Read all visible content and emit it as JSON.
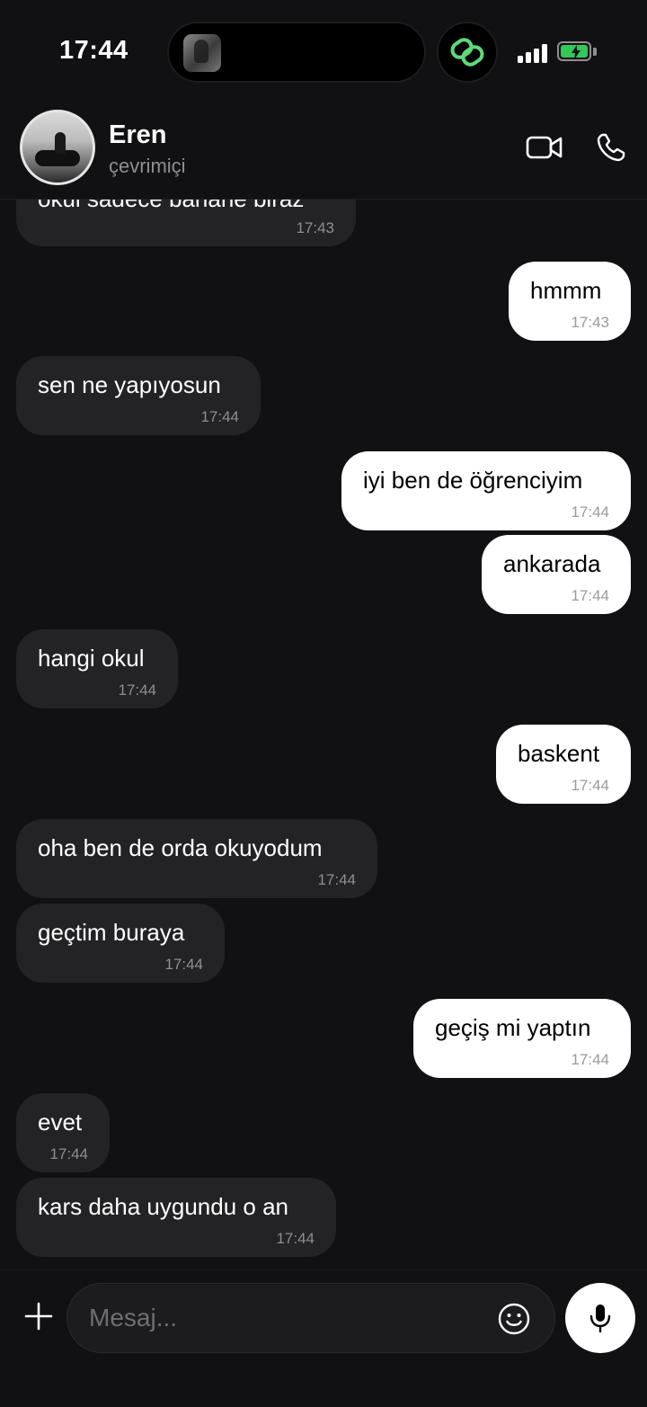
{
  "status_bar": {
    "time": "17:44"
  },
  "header": {
    "contact_name": "Eren",
    "contact_status": "çevrimiçi"
  },
  "messages": [
    {
      "direction": "incoming",
      "text": "okul sadece bahane biraz",
      "time": "17:43"
    },
    {
      "direction": "outgoing",
      "text": "hmmm",
      "time": "17:43"
    },
    {
      "direction": "incoming",
      "text": "sen ne yapıyosun",
      "time": "17:44"
    },
    {
      "direction": "outgoing",
      "text": "iyi ben de öğrenciyim",
      "time": "17:44"
    },
    {
      "direction": "outgoing",
      "text": "ankarada",
      "time": "17:44"
    },
    {
      "direction": "incoming",
      "text": "hangi okul",
      "time": "17:44"
    },
    {
      "direction": "outgoing",
      "text": "baskent",
      "time": "17:44"
    },
    {
      "direction": "incoming",
      "text": "oha ben de orda okuyodum",
      "time": "17:44"
    },
    {
      "direction": "incoming",
      "text": "geçtim buraya",
      "time": "17:44"
    },
    {
      "direction": "outgoing",
      "text": "geçiş mi yaptın",
      "time": "17:44"
    },
    {
      "direction": "incoming",
      "text": "evet",
      "time": "17:44"
    },
    {
      "direction": "incoming",
      "text": "kars daha uygundu o an",
      "time": "17:44"
    }
  ],
  "composer": {
    "placeholder": "Mesaj..."
  },
  "icons": {
    "video_call": "video-camera-icon",
    "voice_call": "phone-icon",
    "attach": "plus-icon",
    "emoji": "smiley-icon",
    "voice_message": "microphone-icon"
  },
  "colors": {
    "background": "#111113",
    "incoming_bubble": "#232325",
    "outgoing_bubble": "#ffffff",
    "accent_green": "#34c759",
    "timestamp": "#8e8e93"
  }
}
